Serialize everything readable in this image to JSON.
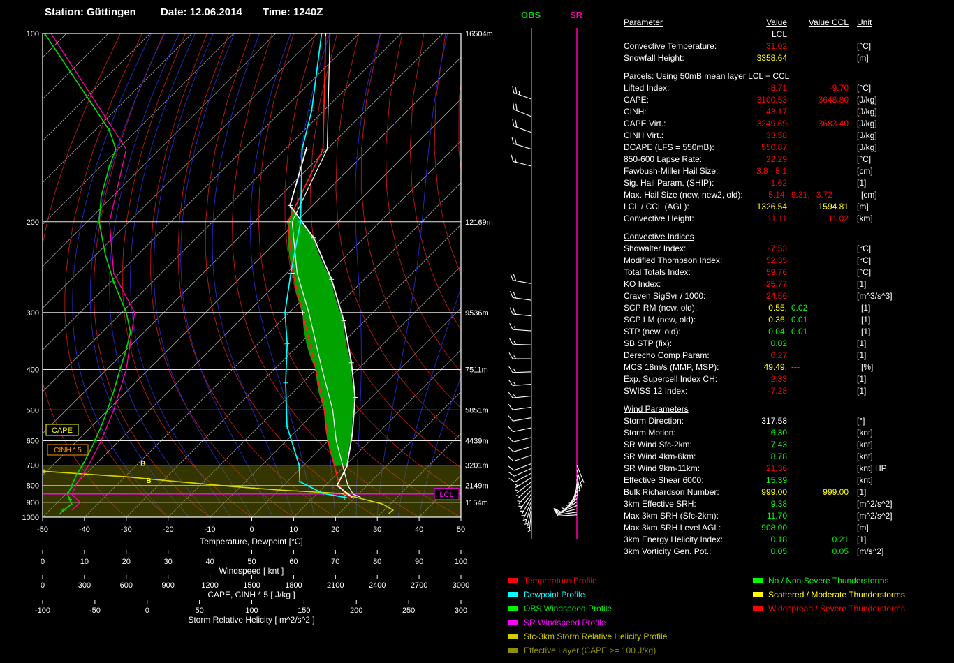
{
  "header": {
    "station_label": "Station:",
    "station": "Güttingen",
    "date_label": "Date:",
    "date": "12.06.2014",
    "time_label": "Time:",
    "time": "1240Z"
  },
  "chart_data": {
    "type": "skewt",
    "pressure_ticks": [
      100,
      200,
      300,
      400,
      500,
      600,
      700,
      800,
      900,
      1000
    ],
    "altitude_labels": {
      "100": "16504m",
      "200": "12169m",
      "300": "9536m",
      "400": "7511m",
      "500": "5851m",
      "600": "4439m",
      "700": "3201m",
      "800": "2149m",
      "900": "1154m"
    },
    "axes": {
      "temp": {
        "label": "Temperature, Dewpoint [°C]",
        "min": -50,
        "max": 50,
        "step": 10
      },
      "wind": {
        "label": "Windspeed [ knt ]",
        "min": 0,
        "max": 100,
        "step": 10
      },
      "cape": {
        "label": "CAPE, CINH * 5 [ J/kg ]",
        "min": 0,
        "max": 3000,
        "step": 300
      },
      "srh": {
        "label": "Storm Relative Helicity [ m^2/s^2 ]",
        "min": -100,
        "max": 300,
        "step": 50
      }
    },
    "temp_profile": [
      [
        100,
        -98
      ],
      [
        150,
        -71
      ],
      [
        200,
        -62
      ],
      [
        250,
        -48.5
      ],
      [
        300,
        -36.8
      ],
      [
        400,
        -20
      ],
      [
        500,
        -8.3
      ],
      [
        600,
        -0.1
      ],
      [
        700,
        7.3
      ],
      [
        800,
        13.4
      ],
      [
        850,
        16.8
      ],
      [
        868,
        19.3
      ]
    ],
    "dewpoint_profile": [
      [
        100,
        -99
      ],
      [
        130,
        -83
      ],
      [
        150,
        -76
      ],
      [
        200,
        -59
      ],
      [
        250,
        -49
      ],
      [
        300,
        -41
      ],
      [
        350,
        -33
      ],
      [
        430,
        -24
      ],
      [
        550,
        -13.3
      ],
      [
        700,
        -1.1
      ],
      [
        780,
        3
      ],
      [
        845,
        11.4
      ],
      [
        868,
        17.5
      ]
    ],
    "parcel_profile": [
      [
        150,
        -75
      ],
      [
        187,
        -65.4
      ],
      [
        214,
        -52
      ],
      [
        257,
        -37.8
      ],
      [
        312,
        -25
      ],
      [
        386,
        -13.1
      ],
      [
        466,
        -3.9
      ],
      [
        572,
        3.9
      ],
      [
        705,
        10.6
      ],
      [
        800,
        12.8
      ],
      [
        868,
        19.3
      ]
    ],
    "obs_wind_profile": [
      [
        100,
        0.5
      ],
      [
        125,
        11
      ],
      [
        140,
        16
      ],
      [
        150,
        17.5
      ],
      [
        160,
        16
      ],
      [
        180,
        14
      ],
      [
        200,
        13.5
      ],
      [
        230,
        15
      ],
      [
        260,
        17
      ],
      [
        300,
        20
      ],
      [
        330,
        21
      ],
      [
        360,
        20
      ],
      [
        400,
        18.5
      ],
      [
        450,
        17
      ],
      [
        500,
        15.5
      ],
      [
        550,
        14
      ],
      [
        600,
        12.5
      ],
      [
        650,
        11
      ],
      [
        700,
        9.5
      ],
      [
        750,
        8
      ],
      [
        800,
        7
      ],
      [
        850,
        6
      ],
      [
        880,
        6.5
      ],
      [
        910,
        7
      ],
      [
        950,
        5
      ],
      [
        980,
        4
      ]
    ],
    "sr_wind_profile": [
      [
        100,
        2
      ],
      [
        150,
        20
      ],
      [
        200,
        16
      ],
      [
        250,
        17
      ],
      [
        300,
        22
      ],
      [
        400,
        20
      ],
      [
        500,
        17
      ],
      [
        600,
        14
      ],
      [
        700,
        11
      ],
      [
        800,
        8
      ],
      [
        850,
        7
      ],
      [
        900,
        9
      ],
      [
        950,
        7
      ]
    ],
    "srh_profile": [
      [
        728,
        -99
      ],
      [
        755,
        -20
      ],
      [
        780,
        30
      ],
      [
        805,
        80
      ],
      [
        825,
        125
      ],
      [
        845,
        185
      ],
      [
        852,
        190
      ],
      [
        880,
        207
      ],
      [
        910,
        225
      ],
      [
        950,
        235
      ],
      [
        975,
        231
      ]
    ],
    "cape_area": {
      "top_p": 187,
      "bottom_p": 705
    },
    "effective_layer": {
      "top_p": 700,
      "bottom_p": 1000
    },
    "lcl_pressure": 848,
    "marker_labels": [
      {
        "p": 690,
        "srh": -4,
        "label": "B"
      },
      {
        "p": 773,
        "srh": 1.5,
        "label": "B"
      }
    ],
    "marker_squares": [
      {
        "p": 728,
        "srh": -99
      },
      {
        "p": 848,
        "srh": 190
      }
    ],
    "chart_labels": {
      "cape": "CAPE",
      "cinh": "CINH * 5",
      "lcl": "LCL"
    },
    "panel_labels": {
      "obs": "OBS",
      "sr": "SR"
    },
    "obs_barbs": [
      [
        125,
        290,
        25
      ],
      [
        133,
        292,
        22
      ],
      [
        141,
        290,
        20
      ],
      [
        150,
        287,
        20
      ],
      [
        160,
        284,
        17
      ],
      [
        262,
        280,
        20
      ],
      [
        283,
        278,
        20
      ],
      [
        305,
        276,
        20
      ],
      [
        328,
        274,
        18
      ],
      [
        352,
        272,
        17
      ],
      [
        378,
        270,
        16
      ],
      [
        405,
        268,
        15
      ],
      [
        433,
        266,
        15
      ],
      [
        462,
        264,
        15
      ],
      [
        492,
        262,
        14
      ],
      [
        523,
        260,
        13
      ],
      [
        555,
        258,
        12
      ],
      [
        588,
        256,
        11
      ],
      [
        622,
        254,
        10
      ],
      [
        657,
        252,
        10
      ],
      [
        693,
        249,
        10
      ],
      [
        715,
        246,
        10
      ],
      [
        737,
        242,
        10
      ],
      [
        759,
        238,
        9
      ],
      [
        781,
        233,
        9
      ],
      [
        803,
        228,
        8
      ],
      [
        825,
        222,
        8
      ],
      [
        847,
        216,
        7
      ],
      [
        869,
        210,
        7
      ],
      [
        891,
        204,
        6
      ],
      [
        913,
        198,
        6
      ],
      [
        935,
        192,
        5
      ],
      [
        957,
        186,
        5
      ],
      [
        979,
        181,
        5
      ]
    ],
    "sr_barbs": [
      [
        700,
        158,
        6
      ],
      [
        722,
        164,
        6
      ],
      [
        744,
        170,
        7
      ],
      [
        766,
        177,
        7
      ],
      [
        788,
        186,
        8
      ],
      [
        810,
        196,
        8
      ],
      [
        832,
        207,
        9
      ],
      [
        854,
        218,
        9
      ],
      [
        876,
        229,
        9
      ],
      [
        898,
        239,
        10
      ],
      [
        920,
        248,
        10
      ],
      [
        942,
        256,
        10
      ],
      [
        964,
        262,
        10
      ],
      [
        984,
        267,
        10
      ]
    ],
    "style": {
      "cape_fill": "#00a300",
      "effective_band": "#6a6a00",
      "grid_white": "#b6b6b6",
      "dry_adiabat": "#c01818",
      "moist_adiabat": "#2828c8",
      "pressure_line": "#e8e8e8",
      "temp_color": "#ff2020",
      "dew_color": "#00ffff",
      "parcel_color": "#ffffff",
      "obs_color": "#00dd00",
      "sr_color": "#ff00aa",
      "srh_color": "#d8d800",
      "lcl_color": "#ff00ff",
      "cape_label": "#ffff00",
      "cinh_label": "#ff9900"
    }
  },
  "table": {
    "headers": {
      "parameter": "Parameter",
      "value_lcl": "Value LCL",
      "value_ccl": "Value CCL",
      "unit": "Unit"
    },
    "rows": [
      {
        "p": "Convective Temperature:",
        "l": [
          [
            "31.02",
            "r"
          ]
        ],
        "u": "[°C]"
      },
      {
        "p": "Snowfall Height:",
        "l": [
          [
            "3358.64",
            "y"
          ]
        ],
        "u": "[m]"
      },
      {
        "section": "Parcels: Using 50mB mean layer LCL + CCL"
      },
      {
        "p": "Lifted Index:",
        "l": [
          [
            "-8.71",
            "r"
          ]
        ],
        "c": {
          "parts": [
            [
              "-9.70",
              "r"
            ]
          ]
        },
        "u": "[°C]"
      },
      {
        "p": "CAPE:",
        "l": [
          [
            "3100.53",
            "r"
          ]
        ],
        "c": {
          "parts": [
            [
              "3648.80",
              "r"
            ]
          ]
        },
        "u": "[J/kg]"
      },
      {
        "p": "CINH:",
        "l": [
          [
            "43.17",
            "r"
          ]
        ],
        "u": "[J/kg]"
      },
      {
        "p": "CAPE Virt.:",
        "l": [
          [
            "3249.69",
            "r"
          ]
        ],
        "c": {
          "parts": [
            [
              "3683.40",
              "r"
            ]
          ]
        },
        "u": "[J/kg]"
      },
      {
        "p": "CINH Virt.:",
        "l": [
          [
            "33.58",
            "r"
          ]
        ],
        "u": "[J/kg]"
      },
      {
        "p": "DCAPE (LFS = 550mB):",
        "l": [
          [
            "550.87",
            "r"
          ]
        ],
        "u": "[J/kg]"
      },
      {
        "p": "850-600 Lapse Rate:",
        "l": [
          [
            "22.29",
            "r"
          ]
        ],
        "u": "[°C]"
      },
      {
        "p": "Fawbush-Miller Hail Size:",
        "l": [
          [
            "3.8 - 5.1",
            "r"
          ]
        ],
        "u": "[cm]"
      },
      {
        "p": "Sig. Hail Param. (SHIP):",
        "l": [
          [
            "1.62",
            "r"
          ]
        ],
        "u": "[1]"
      },
      {
        "p": "Max. Hail Size (new, new2, old):",
        "l": [
          [
            "5.14,",
            "r"
          ]
        ],
        "c": {
          "parts": [
            [
              "9.31,",
              "r"
            ],
            [
              "3.72",
              "r"
            ]
          ],
          "align": "left"
        },
        "u": "[cm]"
      },
      {
        "p": "LCL / CCL (AGL):",
        "l": [
          [
            "1326.54",
            "y"
          ]
        ],
        "c": {
          "parts": [
            [
              "1594.81",
              "y"
            ]
          ]
        },
        "u": "[m]"
      },
      {
        "p": "Convective Height:",
        "l": [
          [
            "11.11",
            "r"
          ]
        ],
        "c": {
          "parts": [
            [
              "11.02",
              "r"
            ]
          ]
        },
        "u": "[km]"
      },
      {
        "section": "Convective Indices"
      },
      {
        "p": "Showalter Index:",
        "l": [
          [
            "-7.53",
            "r"
          ]
        ],
        "u": "[°C]"
      },
      {
        "p": "Modified Thompson Index:",
        "l": [
          [
            "52.35",
            "r"
          ]
        ],
        "u": "[°C]"
      },
      {
        "p": "Total Totals Index:",
        "l": [
          [
            "59.76",
            "r"
          ]
        ],
        "u": "[°C]"
      },
      {
        "p": "KO Index:",
        "l": [
          [
            "-25.77",
            "r"
          ]
        ],
        "u": "[1]"
      },
      {
        "p": "Craven SigSvr / 1000:",
        "l": [
          [
            "24.56",
            "r"
          ]
        ],
        "u": "[m^3/s^3]"
      },
      {
        "p": "SCP RM (new, old):",
        "l": [
          [
            "0.55,",
            "y"
          ]
        ],
        "c": {
          "parts": [
            [
              "0.02",
              "g"
            ]
          ],
          "align": "left"
        },
        "u": "[1]"
      },
      {
        "p": "SCP LM (new, old):",
        "l": [
          [
            "0.36,",
            "y"
          ]
        ],
        "c": {
          "parts": [
            [
              "0.01",
              "g"
            ]
          ],
          "align": "left"
        },
        "u": "[1]"
      },
      {
        "p": "STP (new, old):",
        "l": [
          [
            "0.04,",
            "g"
          ]
        ],
        "c": {
          "parts": [
            [
              "0.01",
              "g"
            ]
          ],
          "align": "left"
        },
        "u": "[1]"
      },
      {
        "p": "SB STP (fix):",
        "l": [
          [
            "0.02",
            "g"
          ]
        ],
        "u": "[1]"
      },
      {
        "p": "Derecho Comp Param:",
        "l": [
          [
            "0.27",
            "r"
          ]
        ],
        "u": "[1]"
      },
      {
        "p": "MCS 18m/s (MMP, MSP):",
        "l": [
          [
            "49.49,",
            "y"
          ]
        ],
        "c": {
          "parts": [
            [
              "---",
              "w"
            ]
          ],
          "align": "left"
        },
        "u": "[%]"
      },
      {
        "p": "Exp. Supercell Index CH:",
        "l": [
          [
            "2.33",
            "r"
          ]
        ],
        "u": "[1]"
      },
      {
        "p": "SWISS 12 Index:",
        "l": [
          [
            "-7.28",
            "r"
          ]
        ],
        "u": "[1]"
      },
      {
        "section": "Wind Parameters"
      },
      {
        "p": "Storm Direction:",
        "l": [
          [
            "317.58",
            "w"
          ]
        ],
        "u": "[°]"
      },
      {
        "p": "Storm Motion:",
        "l": [
          [
            "6.30",
            "g"
          ]
        ],
        "u": "[knt]"
      },
      {
        "p": "SR Wind Sfc-2km:",
        "l": [
          [
            "7.43",
            "g"
          ]
        ],
        "u": "[knt]"
      },
      {
        "p": "SR Wind 4km-6km:",
        "l": [
          [
            "8.78",
            "g"
          ]
        ],
        "u": "[knt]"
      },
      {
        "p": "SR Wind 9km-11km:",
        "l": [
          [
            "21.36",
            "r"
          ]
        ],
        "u": "[knt] HP"
      },
      {
        "p": "Effective Shear 6000:",
        "l": [
          [
            "15.39",
            "g"
          ]
        ],
        "u": "[knt]"
      },
      {
        "p": "Bulk Richardson Number:",
        "l": [
          [
            "999.00",
            "y"
          ]
        ],
        "c": {
          "parts": [
            [
              "999.00",
              "y"
            ]
          ]
        },
        "u": "[1]"
      },
      {
        "p": "3km Effective SRH:",
        "l": [
          [
            "9.38",
            "g"
          ]
        ],
        "u": "[m^2/s^2]"
      },
      {
        "p": "Max 3km SRH (Sfc-2km):",
        "l": [
          [
            "11.70",
            "g"
          ]
        ],
        "u": "[m^2/s^2]"
      },
      {
        "p": "Max 3km SRH Level AGL:",
        "l": [
          [
            "908.00",
            "g"
          ]
        ],
        "u": "[m]"
      },
      {
        "p": "3km Energy Helicity Index:",
        "l": [
          [
            "0.18",
            "g"
          ]
        ],
        "c": {
          "parts": [
            [
              "0.21",
              "g"
            ]
          ]
        },
        "u": "[1]"
      },
      {
        "p": "3km Vorticity Gen. Pot.:",
        "l": [
          [
            "0.05",
            "g"
          ]
        ],
        "c": {
          "parts": [
            [
              "0.05",
              "g"
            ]
          ]
        },
        "u": "[m/s^2]"
      }
    ],
    "value_colors": {
      "r": "#ff0000",
      "y": "#ffff00",
      "g": "#00ff00",
      "w": "#ffffff"
    }
  },
  "legend_left": [
    {
      "label": "Temperature Profile",
      "color": "#ff0000"
    },
    {
      "label": "Dewpoint Profile",
      "color": "#00ffff"
    },
    {
      "label": "OBS Windspeed Profile",
      "color": "#00ee00"
    },
    {
      "label": "SR Windspeed Profile",
      "color": "#ff00ff"
    },
    {
      "label": "Sfc-3km Storm Relative Helicity Profile",
      "color": "#cccc00"
    },
    {
      "label": "Effective Layer (CAPE >= 100 J/kg)",
      "color": "#8f8f00"
    }
  ],
  "legend_right": [
    {
      "label": "No / Non Severe Thunderstorms",
      "color": "#00ff00"
    },
    {
      "label": "Scattered / Moderate Thunderstorms",
      "color": "#ffff00"
    },
    {
      "label": "Widespread / Severe Thunderstorms",
      "color": "#ff0000"
    }
  ]
}
